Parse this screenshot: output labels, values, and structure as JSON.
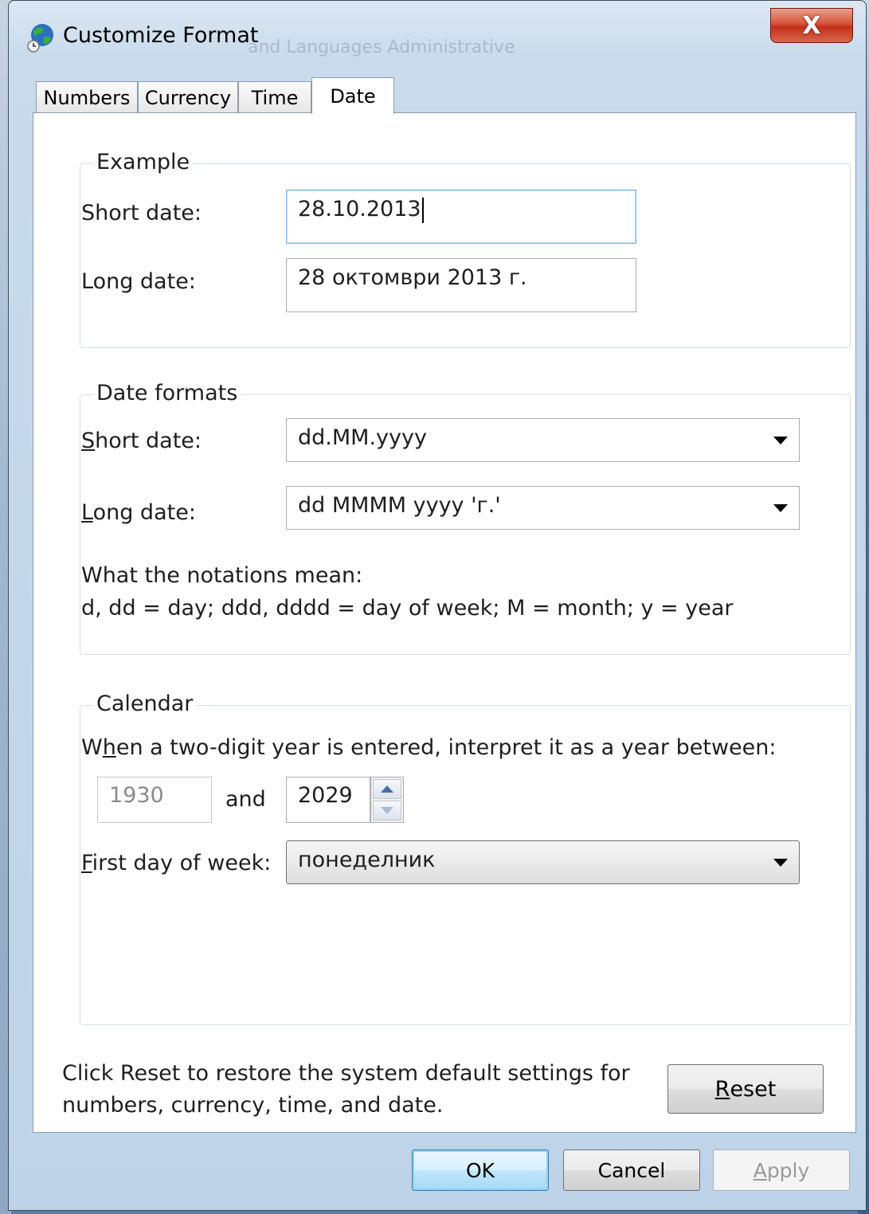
{
  "window": {
    "title": "Customize Format",
    "background_title": "and Languages   Administrative"
  },
  "tabs": [
    {
      "label": "Numbers",
      "active": false
    },
    {
      "label": "Currency",
      "active": false
    },
    {
      "label": "Time",
      "active": false
    },
    {
      "label": "Date",
      "active": true
    }
  ],
  "example": {
    "legend": "Example",
    "short_label": "Short date:",
    "short_value": "28.10.2013",
    "long_label": "Long date:",
    "long_value": "28 октомври 2013 г."
  },
  "date_formats": {
    "legend": "Date formats",
    "short_label_key": "S",
    "short_label_rest": "hort date:",
    "short_value": "dd.MM.yyyy",
    "long_label_key": "L",
    "long_label_rest": "ong date:",
    "long_value": "dd MMMM yyyy 'г.'",
    "notations_title": "What the notations mean:",
    "notations_text": "d, dd = day;  ddd, dddd = day of week;  M = month;  y = year"
  },
  "calendar": {
    "legend": "Calendar",
    "two_digit_pre": "W",
    "two_digit_key": "h",
    "two_digit_rest": "en a two-digit year is entered, interpret it as a year between:",
    "year_from": "1930",
    "and_label": "and",
    "year_to": "2029",
    "first_day_key": "F",
    "first_day_rest": "irst day of week:",
    "first_day_value": "понеделник"
  },
  "reset": {
    "text_line1": "Click Reset to restore the system default settings for",
    "text_line2": "numbers, currency, time, and date.",
    "button_key": "R",
    "button_rest": "eset"
  },
  "buttons": {
    "ok": "OK",
    "cancel": "Cancel",
    "apply_key": "A",
    "apply_rest": "pply"
  },
  "icons": {
    "title": "globe-clock-icon",
    "close": "close-icon",
    "dropdown": "chevron-down-icon",
    "spin_up": "spin-up-icon",
    "spin_down": "spin-down-icon"
  }
}
